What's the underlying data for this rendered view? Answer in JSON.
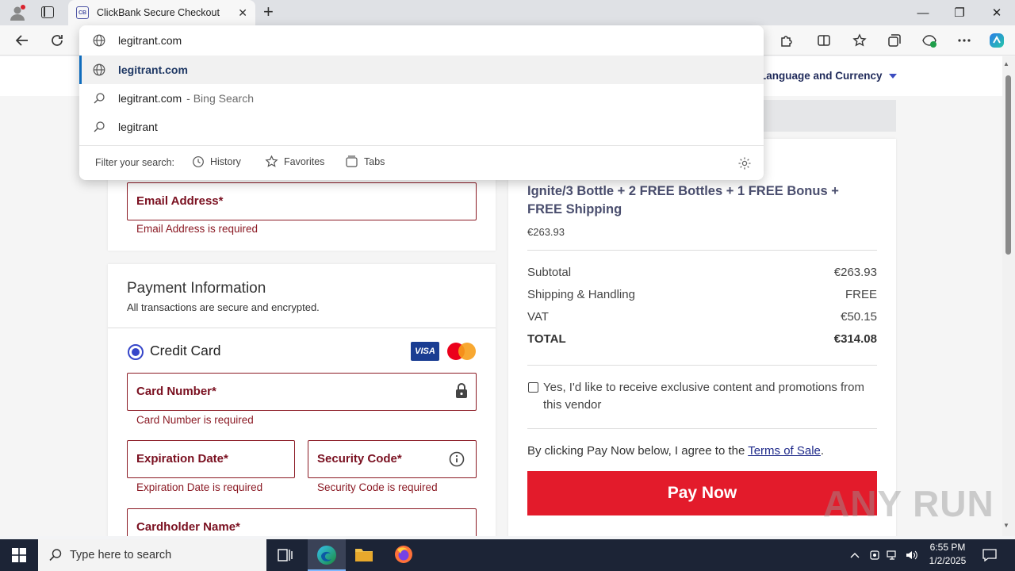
{
  "browser": {
    "tab_title": "ClickBank Secure Checkout",
    "favicon_text": "CB",
    "window_controls": {
      "minimize": "—",
      "maximize": "❐",
      "close": "✕"
    }
  },
  "omnibox": {
    "typed": "legitrant.com",
    "suggestions": [
      {
        "icon": "globe-icon",
        "text": "legitrant.com",
        "suffix": "",
        "selected": true
      },
      {
        "icon": "search-icon",
        "text": "legitrant.com",
        "suffix": "- Bing Search",
        "selected": false
      },
      {
        "icon": "search-icon",
        "text": "legitrant",
        "suffix": "",
        "selected": false
      }
    ],
    "filter_label": "Filter your search:",
    "filters": [
      "History",
      "Favorites",
      "Tabs"
    ]
  },
  "page": {
    "lang_currency": "Language and Currency",
    "email": {
      "label": "Email Address*",
      "error": "Email Address is required"
    },
    "payment": {
      "title": "Payment Information",
      "subtitle": "All transactions are secure and encrypted.",
      "method": "Credit Card",
      "visa_text": "VISA",
      "card_number": {
        "label": "Card Number*",
        "error": "Card Number is required"
      },
      "expiration": {
        "label": "Expiration Date*",
        "error": "Expiration Date is required"
      },
      "security": {
        "label": "Security Code*",
        "error": "Security Code is required"
      },
      "cardholder": {
        "label": "Cardholder Name*"
      }
    },
    "summary": {
      "product": "Ignite/3 Bottle + 2 FREE Bottles + 1 FREE Bonus + FREE Shipping",
      "product_price": "€263.93",
      "rows": [
        {
          "label": "Subtotal",
          "value": "€263.93"
        },
        {
          "label": "Shipping & Handling",
          "value": "FREE"
        },
        {
          "label": "VAT",
          "value": "€50.15"
        },
        {
          "label": "TOTAL",
          "value": "€314.08"
        }
      ],
      "optin": "Yes, I'd like to receive exclusive content and promotions from this vendor",
      "agree_prefix": "By clicking Pay Now below, I agree to the ",
      "terms_link": "Terms of Sale",
      "agree_suffix": ".",
      "pay_button": "Pay Now"
    },
    "watermark": "ANY RUN"
  },
  "taskbar": {
    "search_placeholder": "Type here to search",
    "time": "6:55 PM",
    "date": "1/2/2025"
  },
  "colors": {
    "accent_error": "#8b1a24",
    "pay_button": "#e31b2b",
    "radio": "#3646c9",
    "taskbar": "#1c2436"
  }
}
